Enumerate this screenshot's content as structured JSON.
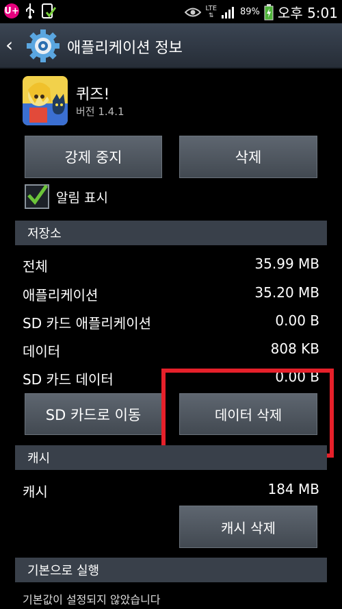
{
  "status_bar": {
    "carrier_badge": "U+",
    "network": "LTE",
    "battery_percent": "89%",
    "time": "오후 5:01",
    "icons": [
      "usb-icon",
      "app-check-icon",
      "eye-icon",
      "signal-icon",
      "battery-icon"
    ]
  },
  "action_bar": {
    "title": "애플리케이션 정보",
    "icon": "gear-icon"
  },
  "app": {
    "name": "퀴즈!",
    "version": "버전 1.4.1"
  },
  "buttons": {
    "force_stop": "강제 중지",
    "uninstall": "삭제",
    "move_to_sd": "SD 카드로 이동",
    "clear_data": "데이터 삭제",
    "clear_cache": "캐시 삭제"
  },
  "notifications": {
    "label": "알림 표시",
    "checked": true
  },
  "storage": {
    "header": "저장소",
    "rows": [
      {
        "label": "전체",
        "value": "35.99 MB"
      },
      {
        "label": "애플리케이션",
        "value": "35.20 MB"
      },
      {
        "label": "SD 카드 애플리케이션",
        "value": "0.00 B"
      },
      {
        "label": "데이터",
        "value": "808 KB"
      },
      {
        "label": "SD 카드 데이터",
        "value": "0.00 B"
      }
    ]
  },
  "cache": {
    "header": "캐시",
    "label": "캐시",
    "value": "184 MB"
  },
  "launch_default": {
    "header": "기본으로 실행",
    "text": "기본값이 설정되지 않았습니다"
  },
  "colors": {
    "accent_highlight": "#e6202a",
    "check_green": "#6cc43a",
    "section_bg": "#39404a"
  }
}
